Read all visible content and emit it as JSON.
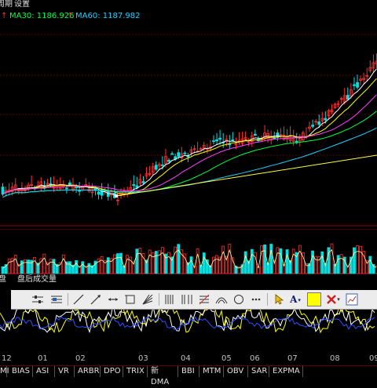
{
  "top_menu": {
    "item1": "周期",
    "item2": "设置"
  },
  "ma_legend": {
    "ma30": {
      "label": "MA30: 1186.926",
      "color": "#00ff40"
    },
    "ma60": {
      "label": "MA60: 1187.982",
      "color": "#20d0ff"
    },
    "arrow": "↑"
  },
  "sub_tabs": {
    "left": "盘",
    "right": "盘后成交量"
  },
  "toolbar": {
    "tools": [
      "drag-icon",
      "lines-icon",
      "grid-icon",
      "line-icon",
      "ray-icon",
      "segment-icon",
      "rect-tool-icon",
      "fan-icon",
      "cycle-lines-icon",
      "fibonacci-icon",
      "gann-icon",
      "arc-icon",
      "circle-icon",
      "more-icon",
      "cursor-icon",
      "text-icon",
      "color-swatch-icon",
      "delete-icon",
      "screenshot-icon"
    ],
    "text_tool": "A",
    "swatch_color": "#ffff00"
  },
  "months": [
    "12",
    "01",
    "02",
    "03",
    "04",
    "05",
    "06",
    "07",
    "08",
    "09"
  ],
  "bottom_tabs": [
    "MI",
    "BIAS",
    "ASI",
    "VR",
    "ARBR",
    "DPO",
    "TRIX",
    "新DMA",
    "BBI",
    "MTM",
    "OBV",
    "SAR",
    "EXPMA"
  ],
  "colors": {
    "up": "#ff3030",
    "down": "#00e0e0",
    "ma5": "#ffffff",
    "ma10": "#ffff00",
    "ma20": "#ff40ff",
    "ma30": "#00ff40",
    "ma60": "#20d0ff",
    "trend": "#ffff40"
  }
}
